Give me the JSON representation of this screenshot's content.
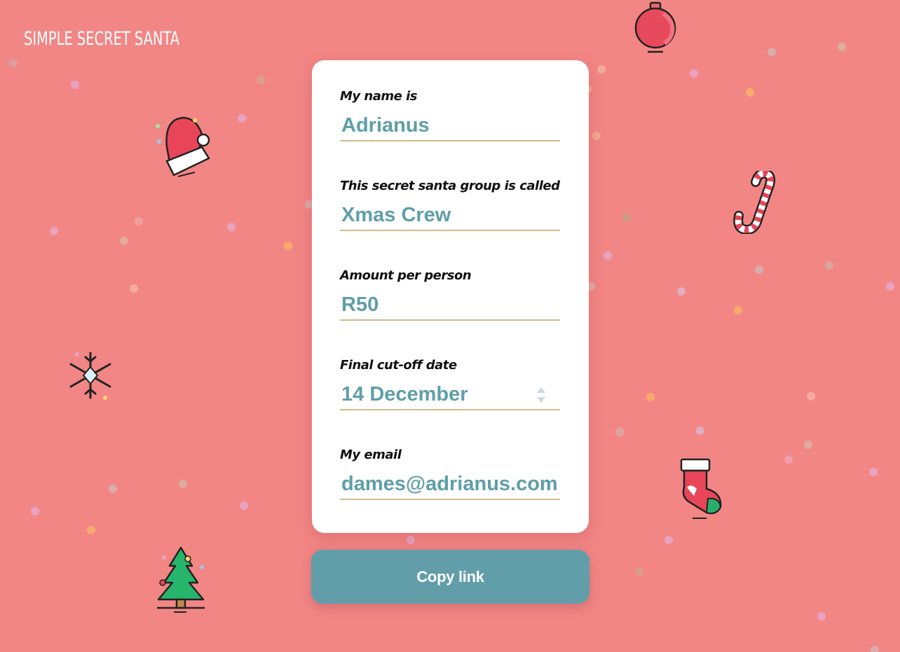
{
  "app": {
    "title": "Simple Secret Santa"
  },
  "form": {
    "name_label": "My name is",
    "name_value": "Adrianus",
    "group_label": "This secret santa group is called",
    "group_value": "Xmas Crew",
    "amount_label": "Amount per person",
    "amount_value": "R50",
    "date_label": "Final cut-off date",
    "date_value": "14 December",
    "email_label": "My email",
    "email_value": "dames@adrianus.com"
  },
  "actions": {
    "copy_label": "Copy link"
  },
  "colors": {
    "background": "#f28685",
    "accent": "#619ea9",
    "input_text": "#5f9ea8",
    "underline": "#d4b98c"
  },
  "icons": [
    "ornament-icon",
    "santa-hat-icon",
    "candy-cane-icon",
    "snowflake-icon",
    "stocking-icon",
    "christmas-tree-icon"
  ]
}
